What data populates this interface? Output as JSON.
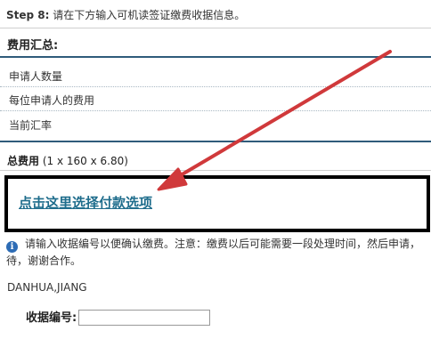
{
  "step": {
    "label": "Step 8:",
    "text": " 请在下方输入可机读签证缴费收据信息。"
  },
  "fees": {
    "title": "费用汇总:",
    "rows": [
      "申请人数量",
      "每位申请人的费用",
      "当前汇率"
    ],
    "total_label": "总费用",
    "total_formula": "(1 x 160 x 6.80)"
  },
  "payment": {
    "link_text": "点击这里选择付款选项"
  },
  "info": {
    "line1": "请输入收据编号以便确认缴费。注意：缴费以后可能需要一段处理时间，然后申请，",
    "line2": "待，谢谢合作。"
  },
  "applicant": {
    "name": "DANHUA,JIANG"
  },
  "receipt": {
    "label": "收据编号:",
    "value": ""
  },
  "colors": {
    "link": "#1f6d8c",
    "divider": "#2f5b7a",
    "arrow": "#d0393b",
    "info_icon": "#2d6cb5"
  }
}
